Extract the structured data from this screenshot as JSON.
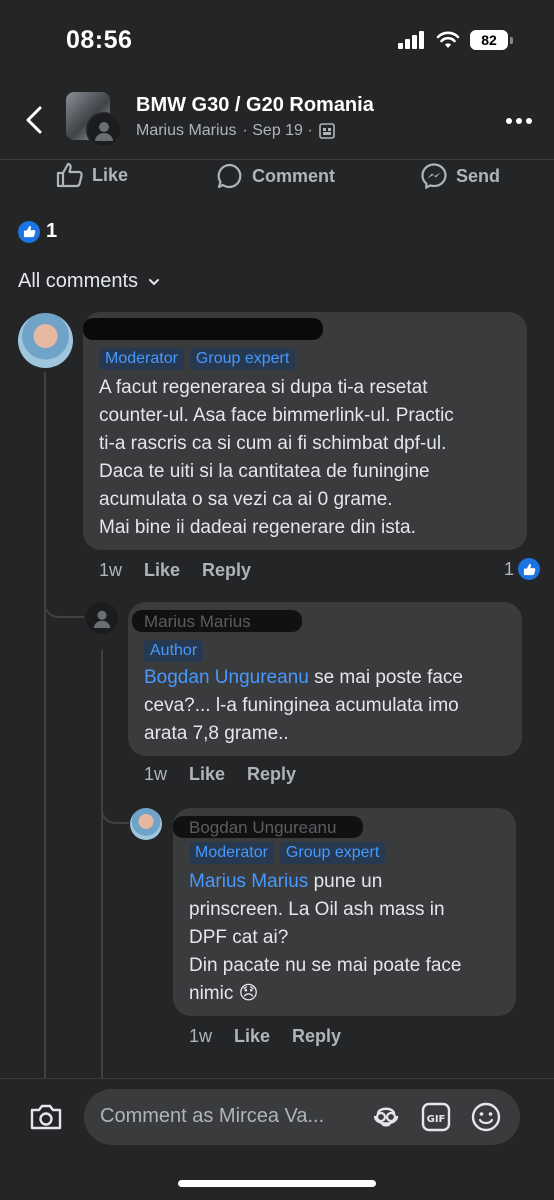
{
  "status": {
    "time": "08:56",
    "battery": "82"
  },
  "header": {
    "title": "BMW G30 / G20 Romania",
    "author": "Marius Marius",
    "date": "· Sep 19 ·"
  },
  "actions": {
    "like": "Like",
    "comment": "Comment",
    "send": "Send"
  },
  "reactions": {
    "count": "1"
  },
  "filter": {
    "label": "All comments"
  },
  "comments": [
    {
      "badges": [
        "Moderator",
        "Group expert"
      ],
      "text_lines": [
        "A facut regenerarea si dupa ti-a resetat",
        "counter-ul. Asa face bimmerlink-ul. Practic",
        "ti-a rascris ca si cum ai fi schimbat dpf-ul.",
        "Daca te uiti si la cantitatea de funingine",
        "acumulata o sa vezi ca ai 0 grame.",
        "Mai bine ii dadeai regenerare din ista."
      ],
      "time": "1w",
      "like": "Like",
      "reply": "Reply",
      "likes": "1"
    },
    {
      "author_faint": "Marius Marius",
      "badges": [
        "Author"
      ],
      "mention": "Bogdan Ungureanu",
      "line1_rest": " se mai poste face",
      "text_lines": [
        "ceva?... l-a funinginea acumulata imo",
        "arata 7,8 grame.."
      ],
      "time": "1w",
      "like": "Like",
      "reply": "Reply"
    },
    {
      "author_faint": "Bogdan Ungureanu",
      "badges": [
        "Moderator",
        "Group expert"
      ],
      "mention": "Marius Marius",
      "line1_rest": " pune un",
      "text_lines": [
        "prinscreen. La Oil ash mass in",
        "DPF cat ai?",
        "Din pacate nu se mai poate face"
      ],
      "last_line": "nimic 😞",
      "time": "1w",
      "like": "Like",
      "reply": "Reply"
    }
  ],
  "composer": {
    "placeholder": "Comment as Mircea Va..."
  },
  "colors": {
    "accent": "#4599ff",
    "like_blue": "#1b74e4",
    "bubble": "#3a3b3c",
    "background": "#242527"
  }
}
